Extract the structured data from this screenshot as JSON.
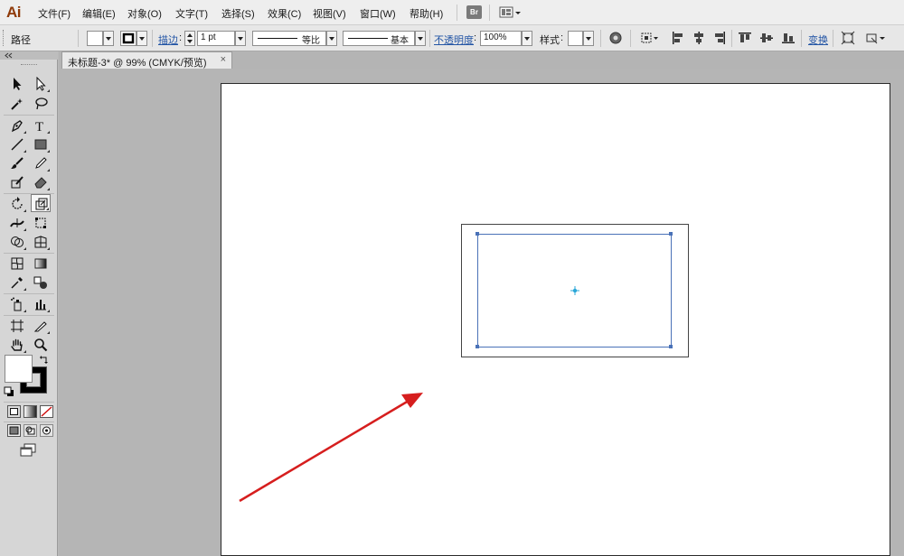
{
  "app": {
    "logo": "Ai"
  },
  "menu": {
    "items": [
      "文件(F)",
      "编辑(E)",
      "对象(O)",
      "文字(T)",
      "选择(S)",
      "效果(C)",
      "视图(V)",
      "窗口(W)",
      "帮助(H)"
    ],
    "bridge_label": "Br"
  },
  "control_bar": {
    "selection_type": "路径",
    "stroke_label": "描边",
    "stroke_weight": "1 pt",
    "variable_width_profile": "等比",
    "brush_definition": "基本",
    "opacity_label": "不透明度",
    "opacity_value": "100%",
    "style_label": "样式",
    "transform_label": "变换"
  },
  "document": {
    "tab_title": "未标题-3* @ 99% (CMYK/预览)",
    "tab_close": "×"
  },
  "colors": {
    "selection_blue": "#4a72b8",
    "center_point": "#2aa7d8",
    "arrow_red": "#d61e1e",
    "rectangle_stroke": "#444444",
    "fill_swatch": "#ffffff",
    "stroke_swatch": "#000000"
  },
  "icons": {
    "swap": "swap-fill-stroke-icon",
    "default": "default-fill-stroke-icon"
  }
}
